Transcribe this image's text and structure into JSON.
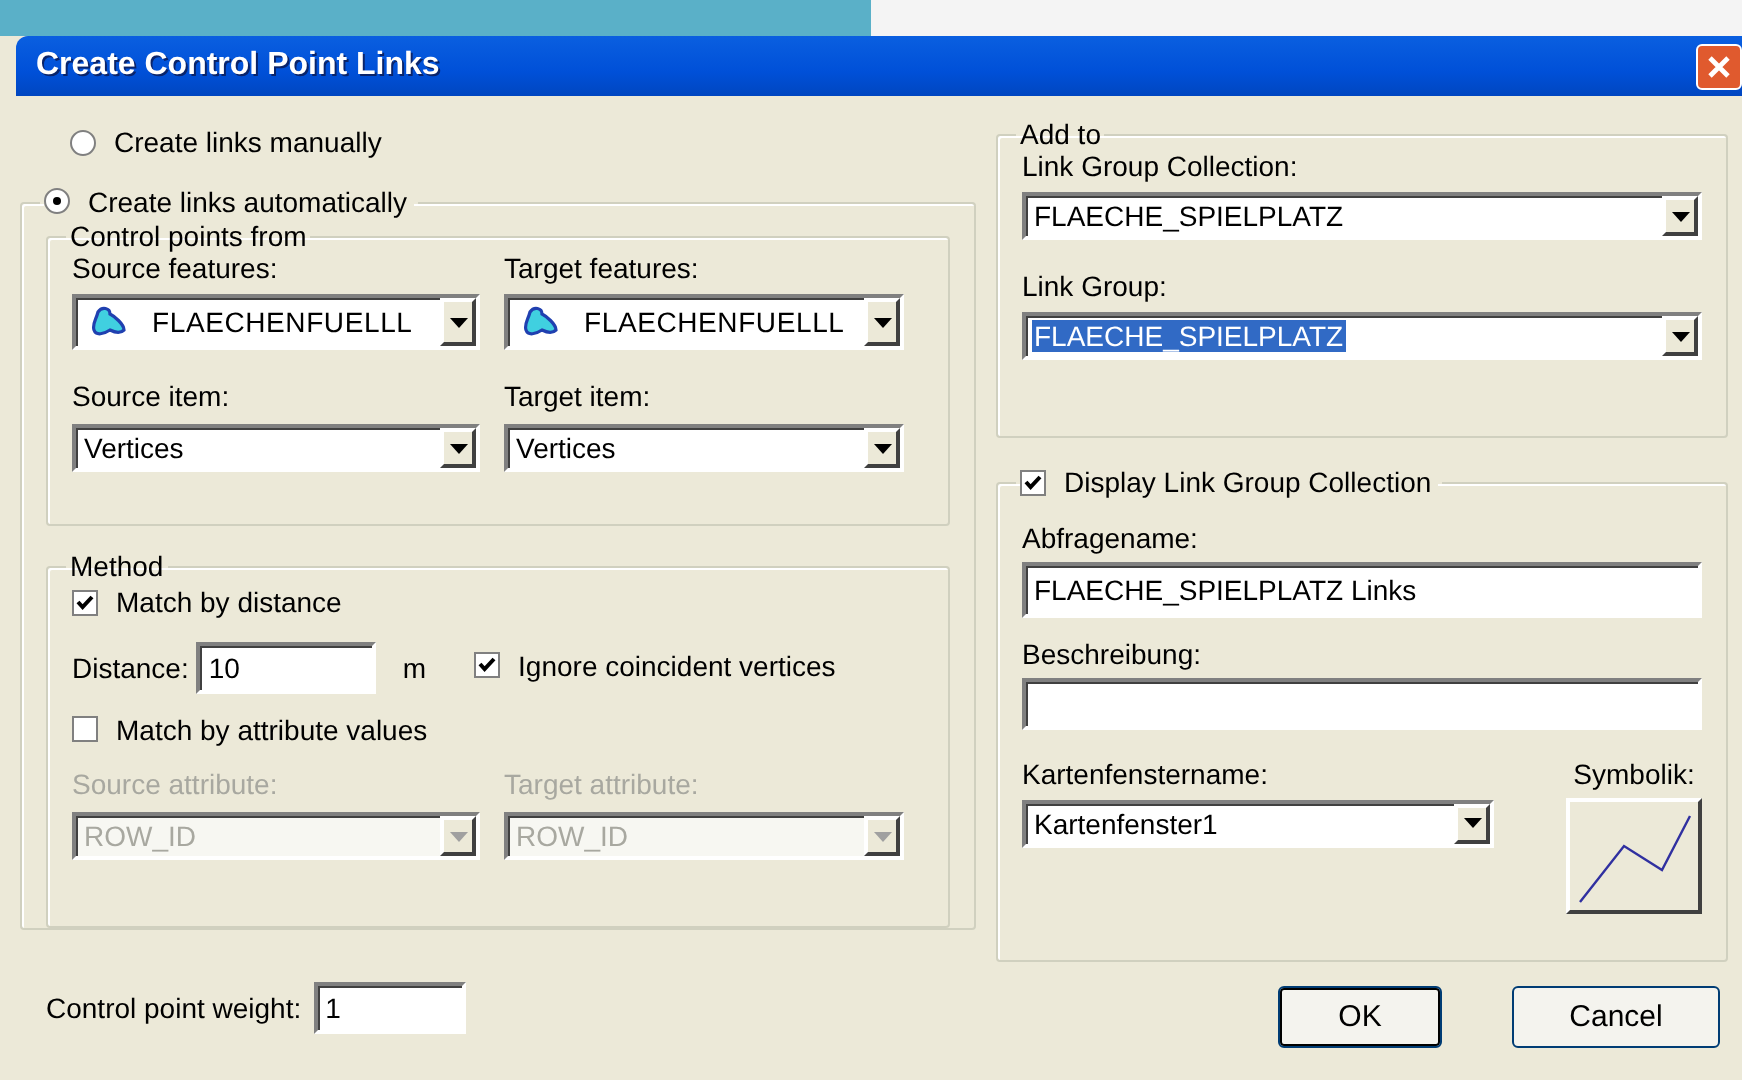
{
  "window": {
    "title": "Create Control Point Links"
  },
  "mode_options": [
    {
      "label": "Create links manually",
      "selected": false
    },
    {
      "label": "Create links automatically",
      "selected": true
    }
  ],
  "control_points_from": {
    "title": "Control points from",
    "source_features": {
      "label": "Source features:",
      "value": "FLAECHENFUELLL"
    },
    "target_features": {
      "label": "Target features:",
      "value": "FLAECHENFUELLL"
    },
    "source_item": {
      "label": "Source item:",
      "value": "Vertices"
    },
    "target_item": {
      "label": "Target item:",
      "value": "Vertices"
    }
  },
  "method": {
    "title": "Method",
    "match_by_distance": {
      "label": "Match by distance",
      "checked": true
    },
    "distance": {
      "label": "Distance:",
      "value": "10",
      "unit": "m"
    },
    "ignore_coincident": {
      "label": "Ignore coincident vertices",
      "checked": true
    },
    "match_by_attribute": {
      "label": "Match by attribute values",
      "checked": false
    },
    "source_attribute": {
      "label": "Source attribute:",
      "value": "ROW_ID",
      "disabled": true
    },
    "target_attribute": {
      "label": "Target attribute:",
      "value": "ROW_ID",
      "disabled": true
    }
  },
  "control_point_weight": {
    "label": "Control point weight:",
    "value": "1"
  },
  "add_to": {
    "title": "Add to",
    "link_group_collection": {
      "label": "Link Group Collection:",
      "value": "FLAECHE_SPIELPLATZ"
    },
    "link_group": {
      "label": "Link Group:",
      "value": "FLAECHE_SPIELPLATZ",
      "highlighted": true
    }
  },
  "display": {
    "label": "Display Link Group Collection",
    "checked": true,
    "abfragename": {
      "label": "Abfragename:",
      "value": "FLAECHE_SPIELPLATZ Links"
    },
    "beschreibung": {
      "label": "Beschreibung:"
    },
    "kartenfenstername": {
      "label": "Kartenfenstername:",
      "value": "Kartenfenster1"
    },
    "symbolik": {
      "label": "Symbolik:"
    }
  },
  "buttons": [
    {
      "label": "OK",
      "default": true
    },
    {
      "label": "Cancel",
      "default": false
    }
  ]
}
